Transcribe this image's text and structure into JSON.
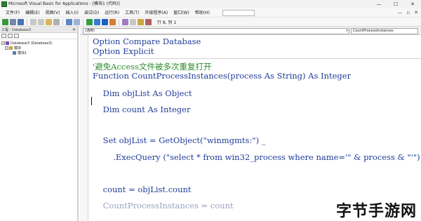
{
  "window": {
    "title": "Microsoft Visual Basic for Applications - [模块1 (代码)]",
    "controls": [
      "—",
      "☐",
      "✕"
    ]
  },
  "menu": {
    "items": [
      "文件(F)",
      "编辑(E)",
      "视图(V)",
      "插入(I)",
      "调试(D)",
      "运行(R)",
      "工具(T)",
      "外接程序(A)",
      "窗口(W)",
      "帮助(H)"
    ],
    "mdi_controls": [
      "—",
      "▫",
      "✕"
    ]
  },
  "toolbar": {
    "position_text": "行 8, 列 1"
  },
  "project_pane": {
    "title": "工程 - Database3",
    "close": "✕",
    "tree": [
      {
        "label": "Database3 (Database3)",
        "toggle": "−",
        "icon": "database-icon"
      },
      {
        "label": "模块",
        "toggle": "−",
        "icon": "folder-icon"
      },
      {
        "label": "模块1",
        "toggle": "",
        "icon": "module-icon"
      }
    ]
  },
  "code_window": {
    "object_combo": "(通用)",
    "proc_combo": "CountProcessInstances",
    "combo_arrow": "▾",
    "lines": [
      "Option Compare Database",
      "Option Explicit",
      "'避免Access文件被多次重复打开",
      "Function CountProcessInstances(process As String) As Integer",
      "    Dim objList As Object",
      "    Dim count As Integer",
      "    Set objList = GetObject(\"winmgmts:\") _",
      "        .ExecQuery (\"select * from win32_process where name='\" & process & \"'\")",
      "    count = objList.count",
      "    CountProcessInstances = count"
    ]
  },
  "watermark": "字节手游网",
  "colors": {
    "keyword": "#1f3c9a",
    "comment": "#2e8b2e"
  }
}
